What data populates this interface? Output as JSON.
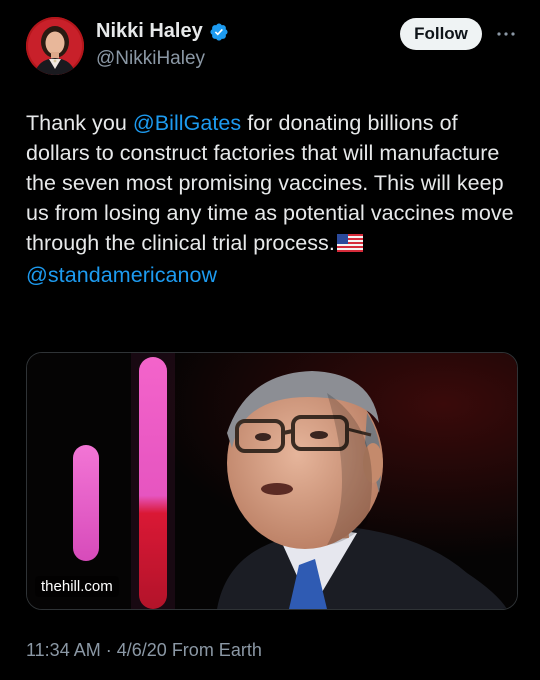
{
  "author": {
    "display_name": "Nikki Haley",
    "handle": "@NikkiHaley",
    "verified": true
  },
  "follow_label": "Follow",
  "tweet": {
    "part1": "Thank you ",
    "mention1": "@BillGates",
    "part2": " for donating billions of dollars to construct factories that will manufacture the seven most promising vaccines. This will keep us from losing any time as potential vaccines move through the clinical trial process.",
    "mention2": "@standamericanow"
  },
  "media": {
    "domain": "thehill.com"
  },
  "footer": {
    "time": "11:34 AM",
    "separator": "·",
    "date": "4/6/20",
    "source": "From Earth"
  },
  "icons": {
    "verified": "verified-badge-icon",
    "more": "more-options-icon",
    "flag": "us-flag-emoji"
  },
  "colors": {
    "background": "#000000",
    "text": "#e7e9ea",
    "secondary": "#8b98a5",
    "link": "#1d9bf0",
    "follow_bg": "#eff3f4"
  }
}
